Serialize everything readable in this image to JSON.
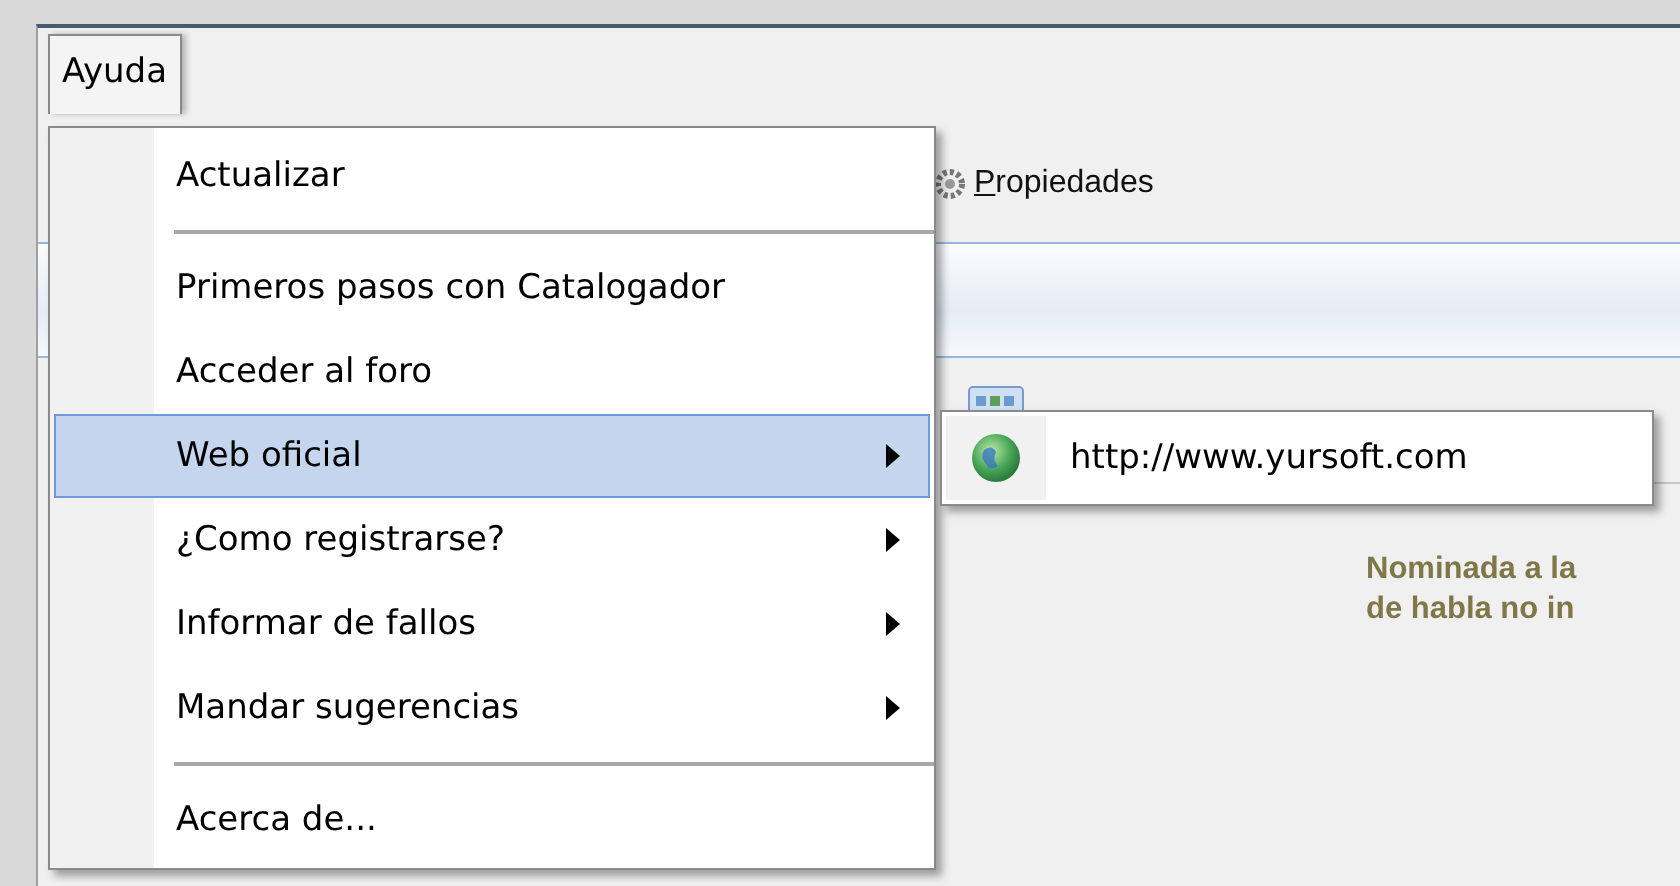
{
  "menu_bar": [
    {
      "label": "Ayuda",
      "selected": true
    }
  ],
  "toolbar": {
    "label": "Propiedades",
    "mnemonic_underlined": true
  },
  "menu": {
    "items": [
      {
        "kind": "item",
        "label": "Actualizar",
        "selected": false,
        "has_submenu": false
      },
      {
        "kind": "separator"
      },
      {
        "kind": "item",
        "label": "Primeros pasos con Catalogador",
        "selected": false,
        "has_submenu": false
      },
      {
        "kind": "item",
        "label": "Acceder al foro",
        "selected": false,
        "has_submenu": false
      },
      {
        "kind": "item",
        "label": "Web oficial",
        "selected": true,
        "has_submenu": true
      },
      {
        "kind": "item",
        "label": "¿Como registrarse?",
        "selected": false,
        "has_submenu": true
      },
      {
        "kind": "item",
        "label": "Informar de fallos",
        "selected": false,
        "has_submenu": true
      },
      {
        "kind": "item",
        "label": "Mandar sugerencias",
        "selected": false,
        "has_submenu": true
      },
      {
        "kind": "separator"
      },
      {
        "kind": "item",
        "label": "Acerca de...",
        "selected": false,
        "has_submenu": false
      }
    ]
  },
  "submenu": {
    "items": [
      {
        "label": "http://www.yursoft.com",
        "selected": false
      }
    ]
  },
  "description": {
    "lines": [
      "Nominada a la",
      "de habla no in"
    ]
  }
}
